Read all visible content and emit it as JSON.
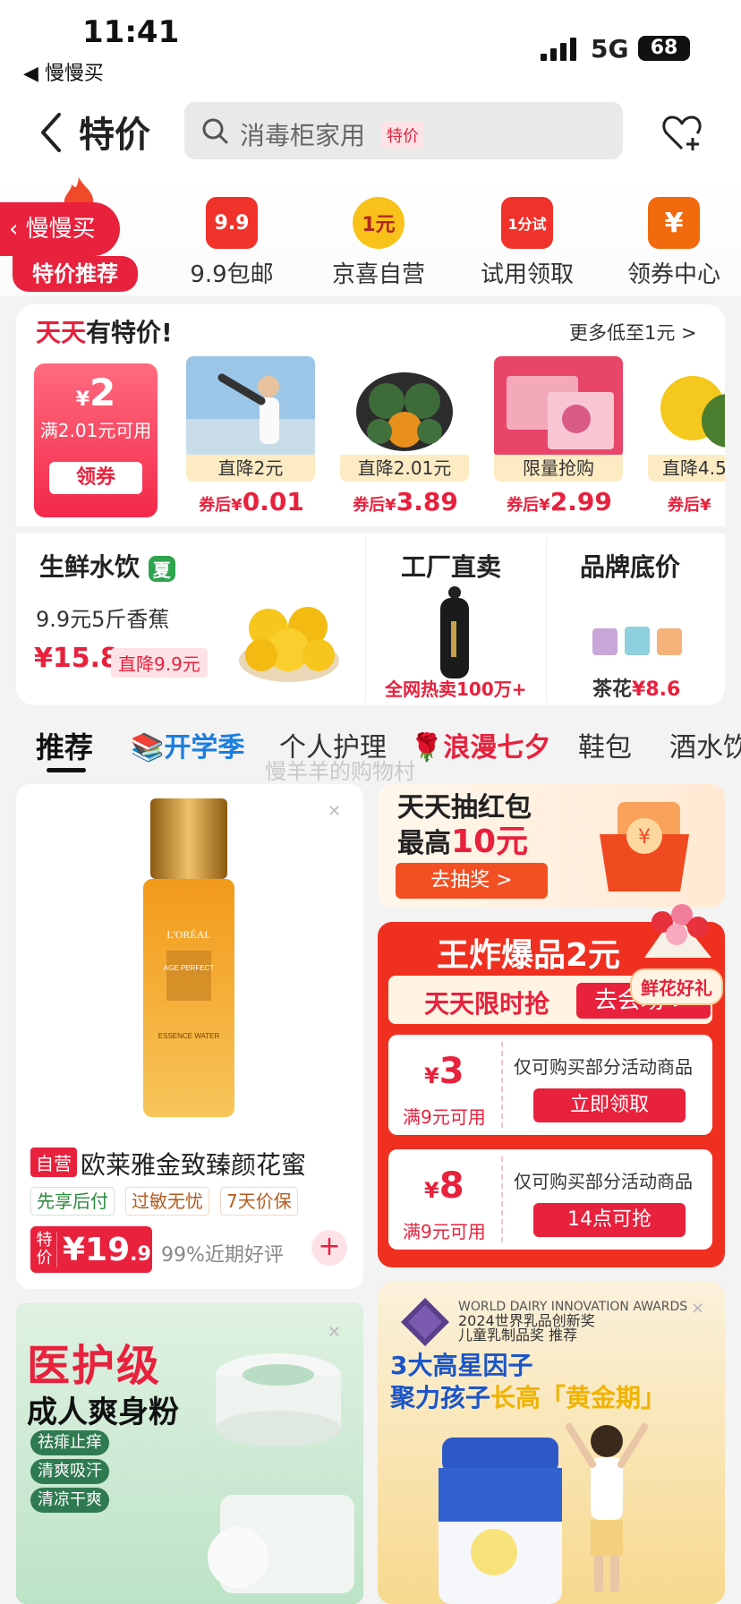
{
  "status": {
    "time": "11:41",
    "back_app": "◀ 慢慢买",
    "network": "5G",
    "battery": "68"
  },
  "header": {
    "title": "特价",
    "search_placeholder": "消毒柜家用",
    "search_tag": "特价"
  },
  "category_bar": {
    "left_pill": "慢慢买",
    "left_sub": "特价推荐",
    "items": [
      {
        "label": "9.9包邮",
        "icon_text": "9.9",
        "color": "#f0322b"
      },
      {
        "label": "京喜自营",
        "icon_text": "1元",
        "color": "#f8c21a"
      },
      {
        "label": "试用领取",
        "icon_text": "1分试",
        "color": "#f0322b"
      },
      {
        "label": "领券中心",
        "icon_text": "¥",
        "color": "#f26a0e"
      }
    ]
  },
  "daily_deals": {
    "title_red": "天天",
    "title_black": "有特价!",
    "more": "更多低至1元 >",
    "coupon": {
      "currency": "¥",
      "amount": "2",
      "condition": "满2.01元可用",
      "button": "领券"
    },
    "products": [
      {
        "tag": "直降2元",
        "price_prefix": "券后¥",
        "price": "0.01"
      },
      {
        "tag": "直降2.01元",
        "price_prefix": "券后¥",
        "price": "3.89"
      },
      {
        "tag": "限量抢购",
        "price_prefix": "券后¥",
        "price": "2.99"
      },
      {
        "tag": "直降4.5",
        "price_prefix": "券后¥",
        "price": ""
      }
    ]
  },
  "sections": {
    "fresh": {
      "title": "生鲜水饮",
      "tag": "夏",
      "desc": "9.9元5斤香蕉",
      "price": "¥15.8",
      "drop": "直降9.9元"
    },
    "factory": {
      "title": "工厂直卖",
      "sub": "全网热卖100万+"
    },
    "brand": {
      "title": "品牌底价",
      "price_label": "茶花",
      "price": "¥8.6"
    }
  },
  "tabs": [
    "推荐",
    "📚开学季",
    "个人护理",
    "🌹浪漫七夕",
    "鞋包",
    "酒水饮"
  ],
  "watermark": "慢羊羊的购物村",
  "feed": {
    "loreal": {
      "self": "自营",
      "name": "欧莱雅金致臻颜花蜜",
      "pills": [
        "先享后付",
        "过敏无忧",
        "7天价保"
      ],
      "badge": "特价",
      "price_int": "¥19",
      "price_dec": ".9",
      "rating": "99%近期好评",
      "bottle_brand": "L'ORÉAL",
      "bottle_line": "AGE PERFECT",
      "bottle_sub": "ESSENCE WATER"
    },
    "lottery": {
      "line1": "天天抽红包",
      "line2_a": "最高",
      "line2_b": "10元",
      "button": "去抽奖 >"
    },
    "flash": {
      "title": "王炸爆品2元",
      "bar": "天天限时抢",
      "bar_btn": "去会场 >",
      "coupons": [
        {
          "cur": "¥",
          "amt": "3",
          "cond": "满9元可用",
          "desc": "仅可购买部分活动商品",
          "btn": "立即领取"
        },
        {
          "cur": "¥",
          "amt": "8",
          "cond": "满9元可用",
          "desc": "仅可购买部分活动商品",
          "btn": "14点可抢"
        }
      ],
      "flower": "鲜花好礼"
    },
    "powder": {
      "title": "医护级",
      "sub": "成人爽身粉",
      "chips": [
        "祛痱止痒",
        "清爽吸汗",
        "清凉干爽"
      ]
    },
    "milk": {
      "award1": "WORLD DAIRY INNOVATION AWARDS",
      "award2": "2024世界乳品创新奖",
      "award3": "儿童乳制品奖 推荐",
      "h1": "3大高星因子",
      "h2a": "聚力孩子",
      "h2b": "长高「黄金期」"
    }
  }
}
